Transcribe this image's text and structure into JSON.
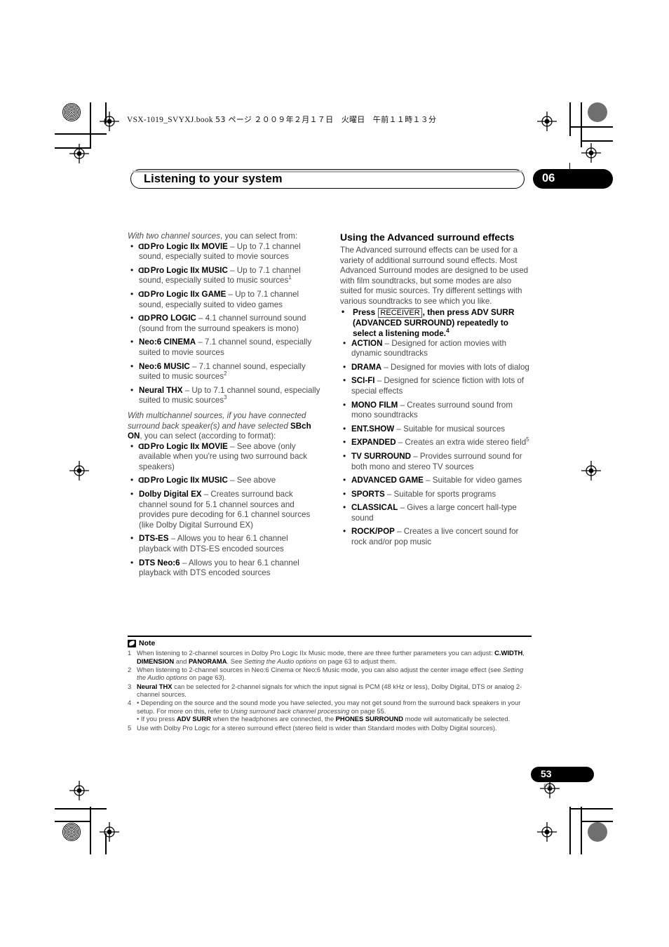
{
  "header": {
    "book_line": "VSX-1019_SVYXJ.book",
    "book_line_page": "53 ページ",
    "book_line_date": "２００９年２月１７日　火曜日　午前１１時１３分",
    "chapter_title": "Listening to your system",
    "chapter_number": "06"
  },
  "left_column": {
    "lead1_italic": "With two channel sources",
    "lead1_rest": ", you can select from:",
    "list1": [
      {
        "dolby": true,
        "term": "Pro Logic IIx MOVIE",
        "desc": " – Up to 7.1 channel sound, especially suited to movie sources",
        "sup": ""
      },
      {
        "dolby": true,
        "term": "Pro Logic IIx MUSIC",
        "desc": " – Up to 7.1 channel sound, especially suited to music sources",
        "sup": "1"
      },
      {
        "dolby": true,
        "term": "Pro Logic IIx GAME",
        "desc": " – Up to 7.1 channel sound, especially suited to video games",
        "sup": ""
      },
      {
        "dolby": true,
        "term": "PRO LOGIC",
        "desc": " – 4.1 channel surround sound (sound from the surround speakers is mono)",
        "sup": ""
      },
      {
        "dolby": false,
        "term": "Neo:6 CINEMA",
        "desc": " – 7.1 channel sound, especially suited to movie sources",
        "sup": ""
      },
      {
        "dolby": false,
        "term": "Neo:6 MUSIC",
        "desc": " – 7.1 channel sound, especially suited to music sources",
        "sup": "2"
      },
      {
        "dolby": false,
        "term": "Neural THX",
        "desc": " – Up to 7.1 channel sound, especially suited to music sources",
        "sup": "3"
      }
    ],
    "lead2_a": "With multichannel sources, if you have connected surround back speaker(s) and have selected ",
    "lead2_bold": "SBch ON",
    "lead2_b": ", you can select (according to format):",
    "list2": [
      {
        "dolby": true,
        "term": "Pro Logic IIx MOVIE",
        "desc": " – See above (only available when you're using two surround back speakers)",
        "sup": ""
      },
      {
        "dolby": true,
        "term": "Pro Logic IIx MUSIC",
        "desc": " – See above",
        "sup": ""
      },
      {
        "dolby": false,
        "term": "Dolby Digital EX",
        "desc": " – Creates surround back channel sound for 5.1 channel sources and provides pure decoding for 6.1 channel sources (like Dolby Digital Surround EX)",
        "sup": ""
      },
      {
        "dolby": false,
        "term": "DTS-ES",
        "desc": " – Allows you to hear 6.1 channel playback with DTS-ES encoded sources",
        "sup": ""
      },
      {
        "dolby": false,
        "term": "DTS Neo:6",
        "desc": " – Allows you to hear 6.1 channel playback with DTS encoded sources",
        "sup": ""
      }
    ]
  },
  "right_column": {
    "heading": "Using the Advanced surround effects",
    "intro": "The Advanced surround effects can be used for a variety of additional surround sound effects. Most Advanced Surround modes are designed to be used with film soundtracks, but some modes are also suited for music sources. Try different settings with various soundtracks to see which you like.",
    "step_pre": "Press ",
    "step_key": "RECEIVER",
    "step_post": ", then press ADV SURR (ADVANCED SURROUND) repeatedly to select a listening mode.",
    "step_sup": "4",
    "list": [
      {
        "term": "ACTION",
        "desc": " – Designed for action movies with dynamic soundtracks",
        "sup": ""
      },
      {
        "term": "DRAMA",
        "desc": " – Designed for movies with lots of dialog",
        "sup": ""
      },
      {
        "term": "SCI-FI",
        "desc": " – Designed for science fiction with lots of special effects",
        "sup": ""
      },
      {
        "term": "MONO FILM",
        "desc": " – Creates surround sound from mono soundtracks",
        "sup": ""
      },
      {
        "term": "ENT.SHOW",
        "desc": " – Suitable for musical sources",
        "sup": ""
      },
      {
        "term": "EXPANDED",
        "desc": " – Creates an extra wide stereo field",
        "sup": "5"
      },
      {
        "term": "TV SURROUND",
        "desc": " – Provides surround sound for both mono and stereo TV sources",
        "sup": ""
      },
      {
        "term": "ADVANCED GAME",
        "desc": " – Suitable for video games",
        "sup": ""
      },
      {
        "term": "SPORTS",
        "desc": " – Suitable for sports programs",
        "sup": ""
      },
      {
        "term": "CLASSICAL",
        "desc": " – Gives a large concert hall-type sound",
        "sup": ""
      },
      {
        "term": "ROCK/POP",
        "desc": " – Creates a live concert sound for rock and/or pop music",
        "sup": ""
      }
    ]
  },
  "note": {
    "label": "Note",
    "items": [
      {
        "num": "1",
        "parts": [
          {
            "t": "When listening to 2-channel sources in Dolby Pro Logic IIx Music mode, there are three further parameters you can adjust: ",
            "s": "n"
          },
          {
            "t": "C.WIDTH",
            "s": "b"
          },
          {
            "t": ", ",
            "s": "n"
          },
          {
            "t": "DIMENSION",
            "s": "b"
          },
          {
            "t": " and ",
            "s": "n"
          },
          {
            "t": "PANORAMA",
            "s": "b"
          },
          {
            "t": ". See ",
            "s": "n"
          },
          {
            "t": "Setting the Audio options",
            "s": "i"
          },
          {
            "t": " on page 63 to adjust them.",
            "s": "n"
          }
        ]
      },
      {
        "num": "2",
        "parts": [
          {
            "t": "When listening to 2-channel sources in Neo:6 Cinema or Neo:6 Music mode, you can also adjust the center image effect (see ",
            "s": "n"
          },
          {
            "t": "Setting the Audio options",
            "s": "i"
          },
          {
            "t": " on page 63).",
            "s": "n"
          }
        ]
      },
      {
        "num": "3",
        "parts": [
          {
            "t": "Neural THX",
            "s": "b"
          },
          {
            "t": " can be selected for 2-channel signals for which the input signal is PCM (48 kHz or less), Dolby Digital, DTS or analog 2-channel sources.",
            "s": "n"
          }
        ]
      },
      {
        "num": "4",
        "parts": [
          {
            "t": "• Depending on the source and the sound mode you have selected, you may not get sound from the surround back speakers in your setup. For more on this, refer to ",
            "s": "n"
          },
          {
            "t": "Using surround back channel processing",
            "s": "i"
          },
          {
            "t": " on page 55.",
            "s": "n"
          },
          {
            "t": "BREAK",
            "s": "br"
          },
          {
            "t": "• If you press ",
            "s": "n"
          },
          {
            "t": "ADV SURR",
            "s": "b"
          },
          {
            "t": " when the headphones are connected, the ",
            "s": "n"
          },
          {
            "t": "PHONES SURROUND",
            "s": "b"
          },
          {
            "t": " mode will automatically be selected.",
            "s": "n"
          }
        ]
      },
      {
        "num": "5",
        "parts": [
          {
            "t": "Use with Dolby Pro Logic for a stereo surround effect (stereo field is wider than Standard modes with Dolby Digital sources).",
            "s": "n"
          }
        ]
      }
    ]
  },
  "footer": {
    "page_number": "53",
    "language": "En"
  }
}
